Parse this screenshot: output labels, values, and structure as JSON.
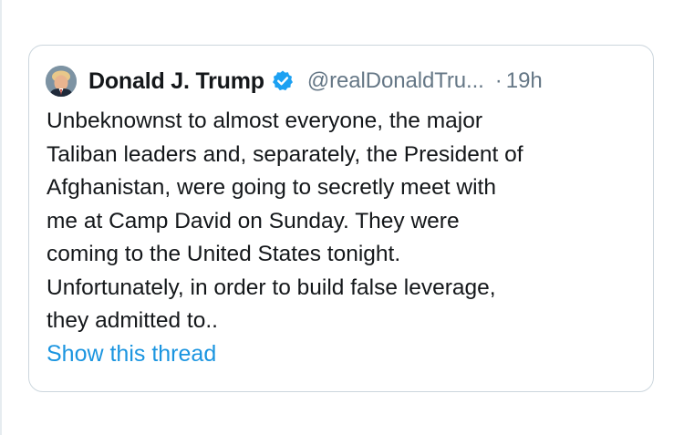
{
  "tweet": {
    "author": {
      "display_name": "Donald J. Trump",
      "handle": "@realDonaldTru...",
      "verified_icon": "verified-badge-icon",
      "avatar_icon": "profile-avatar"
    },
    "separator": "·",
    "timestamp": "19h",
    "text_lines": [
      "Unbeknownst to almost everyone, the major",
      "Taliban leaders and, separately, the President of",
      "Afghanistan, were going to secretly meet with",
      "me at Camp David on Sunday. They were",
      "coming to the United States tonight.",
      "Unfortunately, in order to build false leverage,",
      "they admitted to.."
    ],
    "thread_link": "Show this thread"
  },
  "colors": {
    "primary_text": "#14171a",
    "secondary_text": "#657786",
    "link": "#1b95e0",
    "verified": "#1da1f2",
    "border": "#ccd6dd"
  }
}
